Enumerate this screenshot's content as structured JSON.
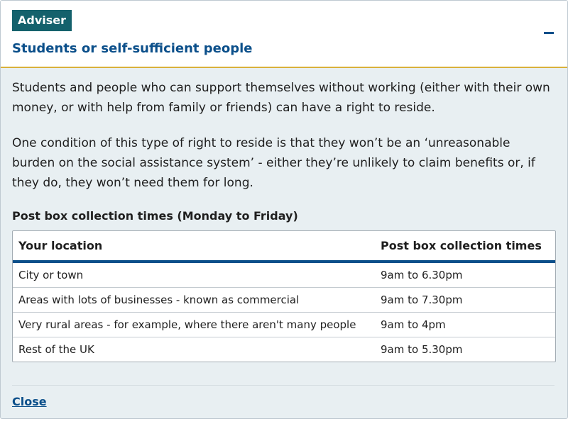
{
  "header": {
    "badge": "Adviser",
    "title": "Students or self-sufficient people",
    "toggle_icon": "minus-icon"
  },
  "content": {
    "paragraphs": [
      "Students and people who can support themselves without working (either with their own money, or with help from family or friends) can have a right to reside.",
      "One condition of this type of right to reside is that they won’t be an ‘unreasonable burden on the social assistance system’ - either they’re unlikely to claim benefits or, if they do, they won’t need them for long."
    ],
    "table_heading": "Post box collection times (Monday to Friday)"
  },
  "table": {
    "headers": [
      "Your location",
      "Post box collection times"
    ],
    "rows": [
      [
        "City or town",
        "9am to 6.30pm"
      ],
      [
        "Areas with lots of businesses - known as commercial",
        "9am to 7.30pm"
      ],
      [
        "Very rural areas - for example, where there aren't many people",
        "9am to 4pm"
      ],
      [
        "Rest of the UK",
        "9am to 5.30pm"
      ]
    ]
  },
  "footer": {
    "close_label": "Close"
  },
  "colors": {
    "badge_bg": "#14616c",
    "title": "#0b4f8a",
    "accent_border": "#d9b13b",
    "panel_bg": "#e8eff2"
  }
}
